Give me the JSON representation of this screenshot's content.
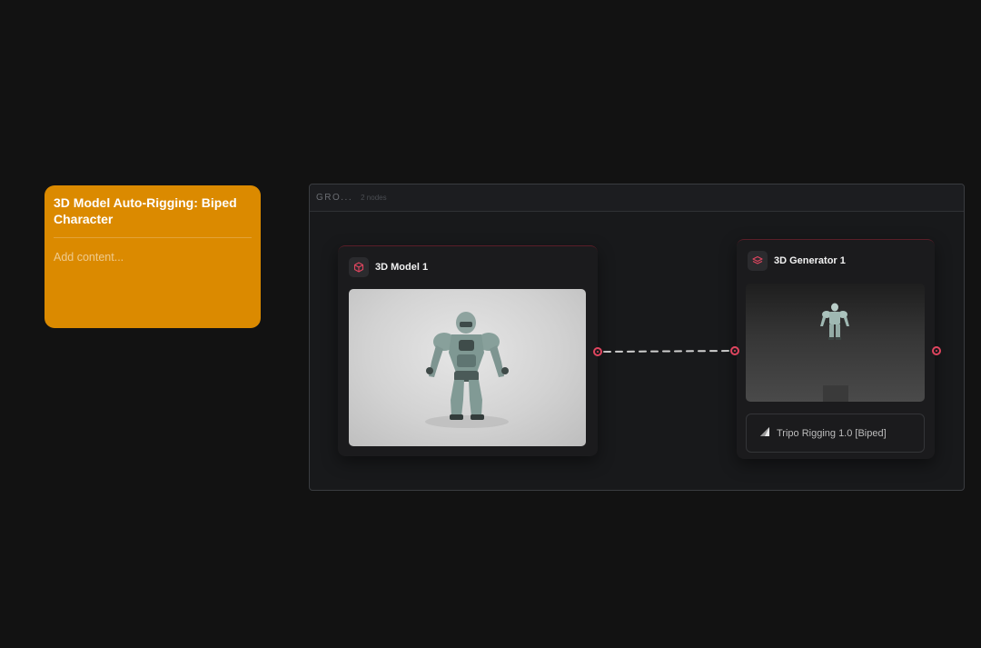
{
  "note": {
    "title": "3D Model Auto-Rigging: Biped Character",
    "placeholder": "Add content..."
  },
  "group": {
    "title": "GRO...",
    "count": "2 nodes"
  },
  "nodes": {
    "model": {
      "title": "3D Model 1",
      "icon": "cube-icon"
    },
    "generator": {
      "title": "3D Generator 1",
      "icon": "layers-icon",
      "setting_label": "Tripo Rigging 1.0 [Biped]"
    }
  },
  "colors": {
    "background": "#121212",
    "note": "#db8a00",
    "accent": "#e0455f"
  }
}
